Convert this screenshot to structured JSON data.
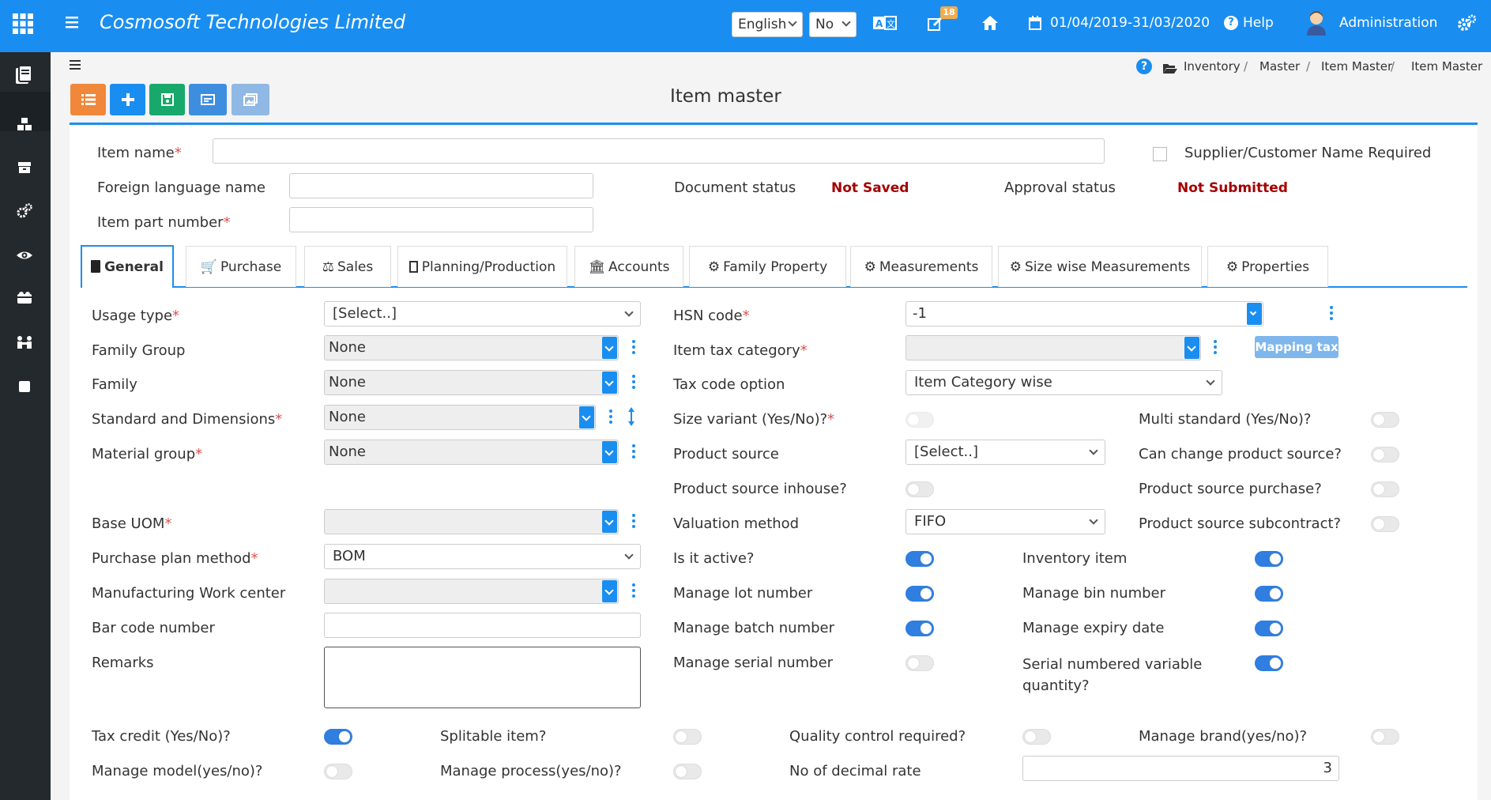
{
  "app": {
    "title": "Cosmosoft Technologies Limited",
    "language": "English",
    "yes_no": "No",
    "notification_count": "18",
    "date_range": "01/04/2019-31/03/2020",
    "help": "Help",
    "user": "Administration"
  },
  "breadcrumb": [
    "Inventory",
    "Master",
    "Item Master",
    "Item Master"
  ],
  "page_title": "Item master",
  "header_fields": {
    "item_name": "Item name",
    "supplier_customer": "Supplier/Customer Name Required",
    "foreign_name": "Foreign language name",
    "document_status_label": "Document status",
    "document_status_value": "Not Saved",
    "approval_status_label": "Approval status",
    "approval_status_value": "Not Submitted",
    "part_number": "Item part number"
  },
  "tabs": [
    "General",
    "Purchase",
    "Sales",
    "Planning/Production",
    "Accounts",
    "Family Property",
    "Measurements",
    "Size wise Measurements",
    "Properties"
  ],
  "left": {
    "usage_type": "Usage type",
    "usage_type_value": "[Select..]",
    "family_group": "Family Group",
    "family_group_value": "None",
    "family": "Family",
    "family_value": "None",
    "std_dim": "Standard and Dimensions",
    "std_dim_value": "None",
    "material_group": "Material group",
    "material_group_value": "None",
    "base_uom": "Base UOM",
    "purchase_plan": "Purchase plan method",
    "purchase_plan_value": "BOM",
    "work_center": "Manufacturing Work center",
    "barcode": "Bar code number",
    "remarks": "Remarks"
  },
  "middle": {
    "hsn": "HSN code",
    "hsn_value": "-1",
    "tax_category": "Item tax category",
    "mapping_tax": "Mapping tax",
    "tax_code_option": "Tax code option",
    "tax_code_value": "Item Category wise",
    "size_variant": "Size variant (Yes/No)?",
    "product_source": "Product source",
    "product_source_value": "[Select..]",
    "product_inhouse": "Product source inhouse?",
    "valuation": "Valuation method",
    "valuation_value": "FIFO",
    "is_active": "Is it active?",
    "manage_lot": "Manage lot number",
    "manage_batch": "Manage batch number",
    "manage_serial": "Manage serial number"
  },
  "right": {
    "multi_standard": "Multi standard (Yes/No)?",
    "can_change_source": "Can change product source?",
    "source_purchase": "Product source purchase?",
    "source_subcontract": "Product source subcontract?",
    "inventory_item": "Inventory item",
    "manage_bin": "Manage bin number",
    "manage_expiry": "Manage expiry date",
    "serial_variable_1": "Serial numbered variable",
    "serial_variable_2": "quantity?"
  },
  "bottom": {
    "tax_credit": "Tax credit (Yes/No)?",
    "splitable": "Splitable item?",
    "quality": "Quality control required?",
    "manage_brand": "Manage brand(yes/no)?",
    "manage_model": "Manage model(yes/no)?",
    "manage_process": "Manage process(yes/no)?",
    "decimal_rate": "No of decimal rate",
    "decimal_value": "3"
  },
  "colors": {
    "topbar": "#1a8ef0",
    "sidebar": "#24292e",
    "required": "#d9534f",
    "status": "#a40000",
    "toggle_on": "#2f7ee0"
  }
}
